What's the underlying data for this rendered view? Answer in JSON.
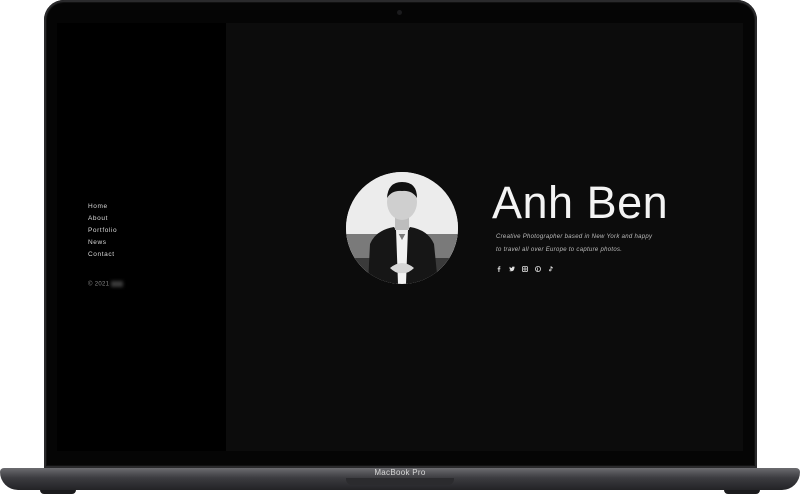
{
  "device": {
    "label": "MacBook Pro"
  },
  "sidebar": {
    "nav": [
      {
        "label": "Home"
      },
      {
        "label": "About"
      },
      {
        "label": "Portfolio"
      },
      {
        "label": "News"
      },
      {
        "label": "Contact"
      }
    ],
    "copyright": "© 2021"
  },
  "hero": {
    "name": "Anh Ben",
    "bio_line1": "Creative Photographer based in New York and happy",
    "bio_line2": "to travel all over Europe to capture photos.",
    "social": [
      {
        "icon": "facebook-icon",
        "glyph": "f"
      },
      {
        "icon": "twitter-icon",
        "glyph": "t"
      },
      {
        "icon": "instagram-icon",
        "glyph": "i"
      },
      {
        "icon": "pinterest-icon",
        "glyph": "p"
      },
      {
        "icon": "tiktok-icon",
        "glyph": "d"
      }
    ]
  },
  "colors": {
    "screen_bg": "#0c0c0c",
    "sidebar_bg": "#000000",
    "text": "#f4f4f4"
  }
}
